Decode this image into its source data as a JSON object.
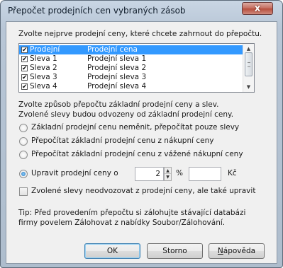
{
  "window": {
    "title": "Přepočet prodejních cen vybraných zásob",
    "close_label": "X"
  },
  "intro_text": "Zvolte nejprve prodejní ceny, které chcete zahrnout do přepočtu.",
  "price_list": {
    "rows": [
      {
        "name": "Prodejní",
        "description": "Prodejní cena",
        "checked": true,
        "selected": true
      },
      {
        "name": "Sleva 1",
        "description": "Prodejní sleva 1",
        "checked": true,
        "selected": false
      },
      {
        "name": "Sleva 2",
        "description": "Prodejní sleva 2",
        "checked": true,
        "selected": false
      },
      {
        "name": "Sleva 3",
        "description": "Prodejní sleva 3",
        "checked": true,
        "selected": false
      },
      {
        "name": "Sleva 4",
        "description": "Prodejní sleva 4",
        "checked": true,
        "selected": false
      }
    ],
    "check_mark": "✔",
    "scroll_up": "▲",
    "scroll_down": "▼"
  },
  "method": {
    "instruction_line1": "Zvolte způsob přepočtu základní prodejní ceny a slev.",
    "instruction_line2": "Zvolené slevy budou odvozeny od základní prodejní ceny.",
    "options": [
      {
        "label": "Základní prodejní cenu neměnit, přepočítat pouze slevy",
        "selected": false
      },
      {
        "label": "Přepočítat základní prodejní cenu z nákupní ceny",
        "selected": false
      },
      {
        "label": "Přepočítat základní prodejní cenu z vážené nákupní ceny",
        "selected": false
      },
      {
        "label": "Upravit prodejní ceny o",
        "selected": true
      }
    ]
  },
  "adjust": {
    "percent_value": "2",
    "percent_unit": "%",
    "amount_value": "",
    "currency_unit": "Kč",
    "spin_up": "▲",
    "spin_down": "▼"
  },
  "independent_checkbox": {
    "label": "Zvolené slevy neodvozovat z prodejní ceny, ale také upravit",
    "checked": false
  },
  "tip": {
    "line1": "Tip: Před provedením přepočtu si zálohujte stávající databázi",
    "line2": "firmy povelem Zálohovat z nabídky Soubor/Zálohování."
  },
  "buttons": {
    "ok": "OK",
    "cancel": "Storno",
    "help_mnemonic": "N",
    "help_rest": "ápověda"
  }
}
